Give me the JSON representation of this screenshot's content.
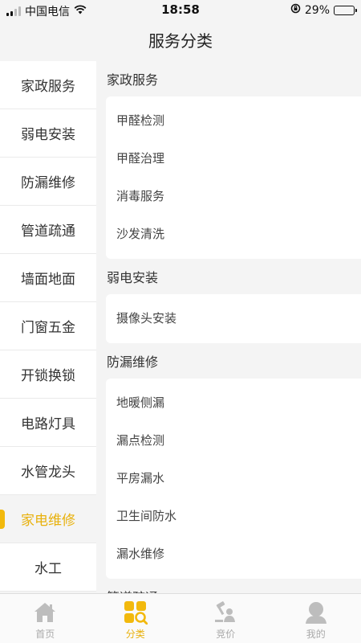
{
  "status_bar": {
    "carrier": "中国电信",
    "time": "18:58",
    "battery": "29%",
    "battery_level": 0.29
  },
  "nav": {
    "title": "服务分类"
  },
  "sidebar": {
    "items": [
      {
        "label": "家政服务"
      },
      {
        "label": "弱电安装"
      },
      {
        "label": "防漏维修"
      },
      {
        "label": "管道疏通"
      },
      {
        "label": "墙面地面"
      },
      {
        "label": "门窗五金"
      },
      {
        "label": "开锁换锁"
      },
      {
        "label": "电路灯具"
      },
      {
        "label": "水管龙头"
      },
      {
        "label": "家电维修"
      },
      {
        "label": "水工"
      }
    ],
    "active_index": 9
  },
  "groups": [
    {
      "title": "家政服务",
      "items": [
        "甲醛检测",
        "甲醛治理",
        "消毒服务",
        "沙发清洗"
      ]
    },
    {
      "title": "弱电安装",
      "items": [
        "摄像头安装"
      ]
    },
    {
      "title": "防漏维修",
      "items": [
        "地暖侧漏",
        "漏点检测",
        "平房漏水",
        "卫生间防水",
        "漏水维修"
      ]
    },
    {
      "title": "管道疏通",
      "items": []
    }
  ],
  "tabbar": {
    "tabs": [
      {
        "label": "首页",
        "icon": "home-icon"
      },
      {
        "label": "分类",
        "icon": "category-icon"
      },
      {
        "label": "竞价",
        "icon": "bid-icon"
      },
      {
        "label": "我的",
        "icon": "profile-icon"
      }
    ],
    "active_index": 1
  },
  "colors": {
    "accent": "#f2b90d",
    "accent_text": "#e8b10d",
    "inactive_icon": "#bdbdbd",
    "background": "#f4f4f4"
  }
}
